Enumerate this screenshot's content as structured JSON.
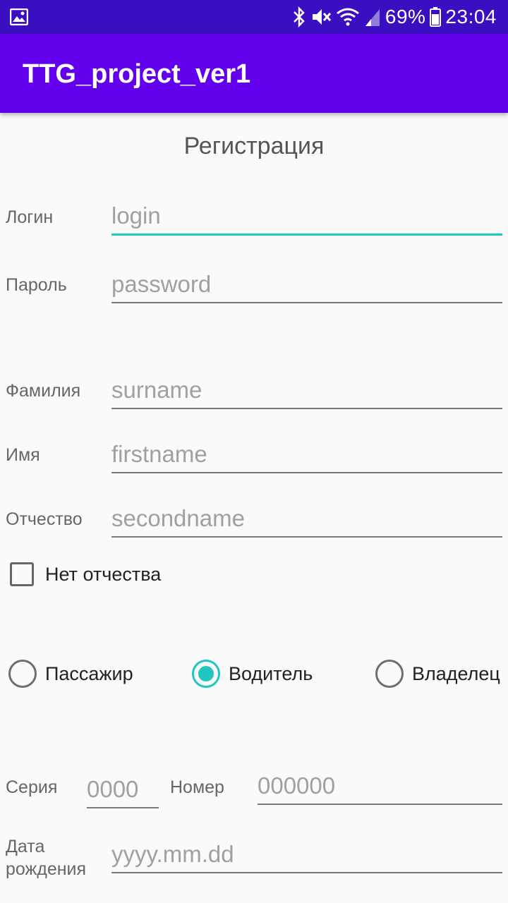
{
  "status_bar": {
    "battery_percent": "69%",
    "time": "23:04",
    "icons": [
      "gallery-icon",
      "bluetooth-icon",
      "mute-icon",
      "wifi-icon",
      "signal-icon",
      "battery-icon"
    ]
  },
  "app_bar": {
    "title": "TTG_project_ver1"
  },
  "form": {
    "heading": "Регистрация",
    "login": {
      "label": "Логин",
      "placeholder": "login"
    },
    "password": {
      "label": "Пароль",
      "placeholder": "password"
    },
    "surname": {
      "label": "Фамилия",
      "placeholder": "surname"
    },
    "firstname": {
      "label": "Имя",
      "placeholder": "firstname"
    },
    "secondname": {
      "label": "Отчество",
      "placeholder": "secondname"
    },
    "no_secondname": {
      "label": "Нет отчества",
      "checked": false
    },
    "roles": [
      {
        "label": "Пассажир",
        "selected": false
      },
      {
        "label": "Водитель",
        "selected": true
      },
      {
        "label": "Владелец",
        "selected": false
      }
    ],
    "series": {
      "label": "Серия",
      "placeholder": "0000"
    },
    "number": {
      "label": "Номер",
      "placeholder": "000000"
    },
    "birthdate": {
      "label_line1": "Дата",
      "label_line2": "рождения",
      "placeholder": "yyyy.mm.dd"
    }
  },
  "colors": {
    "status_bar": "#3a0fc2",
    "app_bar": "#6200ee",
    "accent": "#1fc6c2"
  }
}
